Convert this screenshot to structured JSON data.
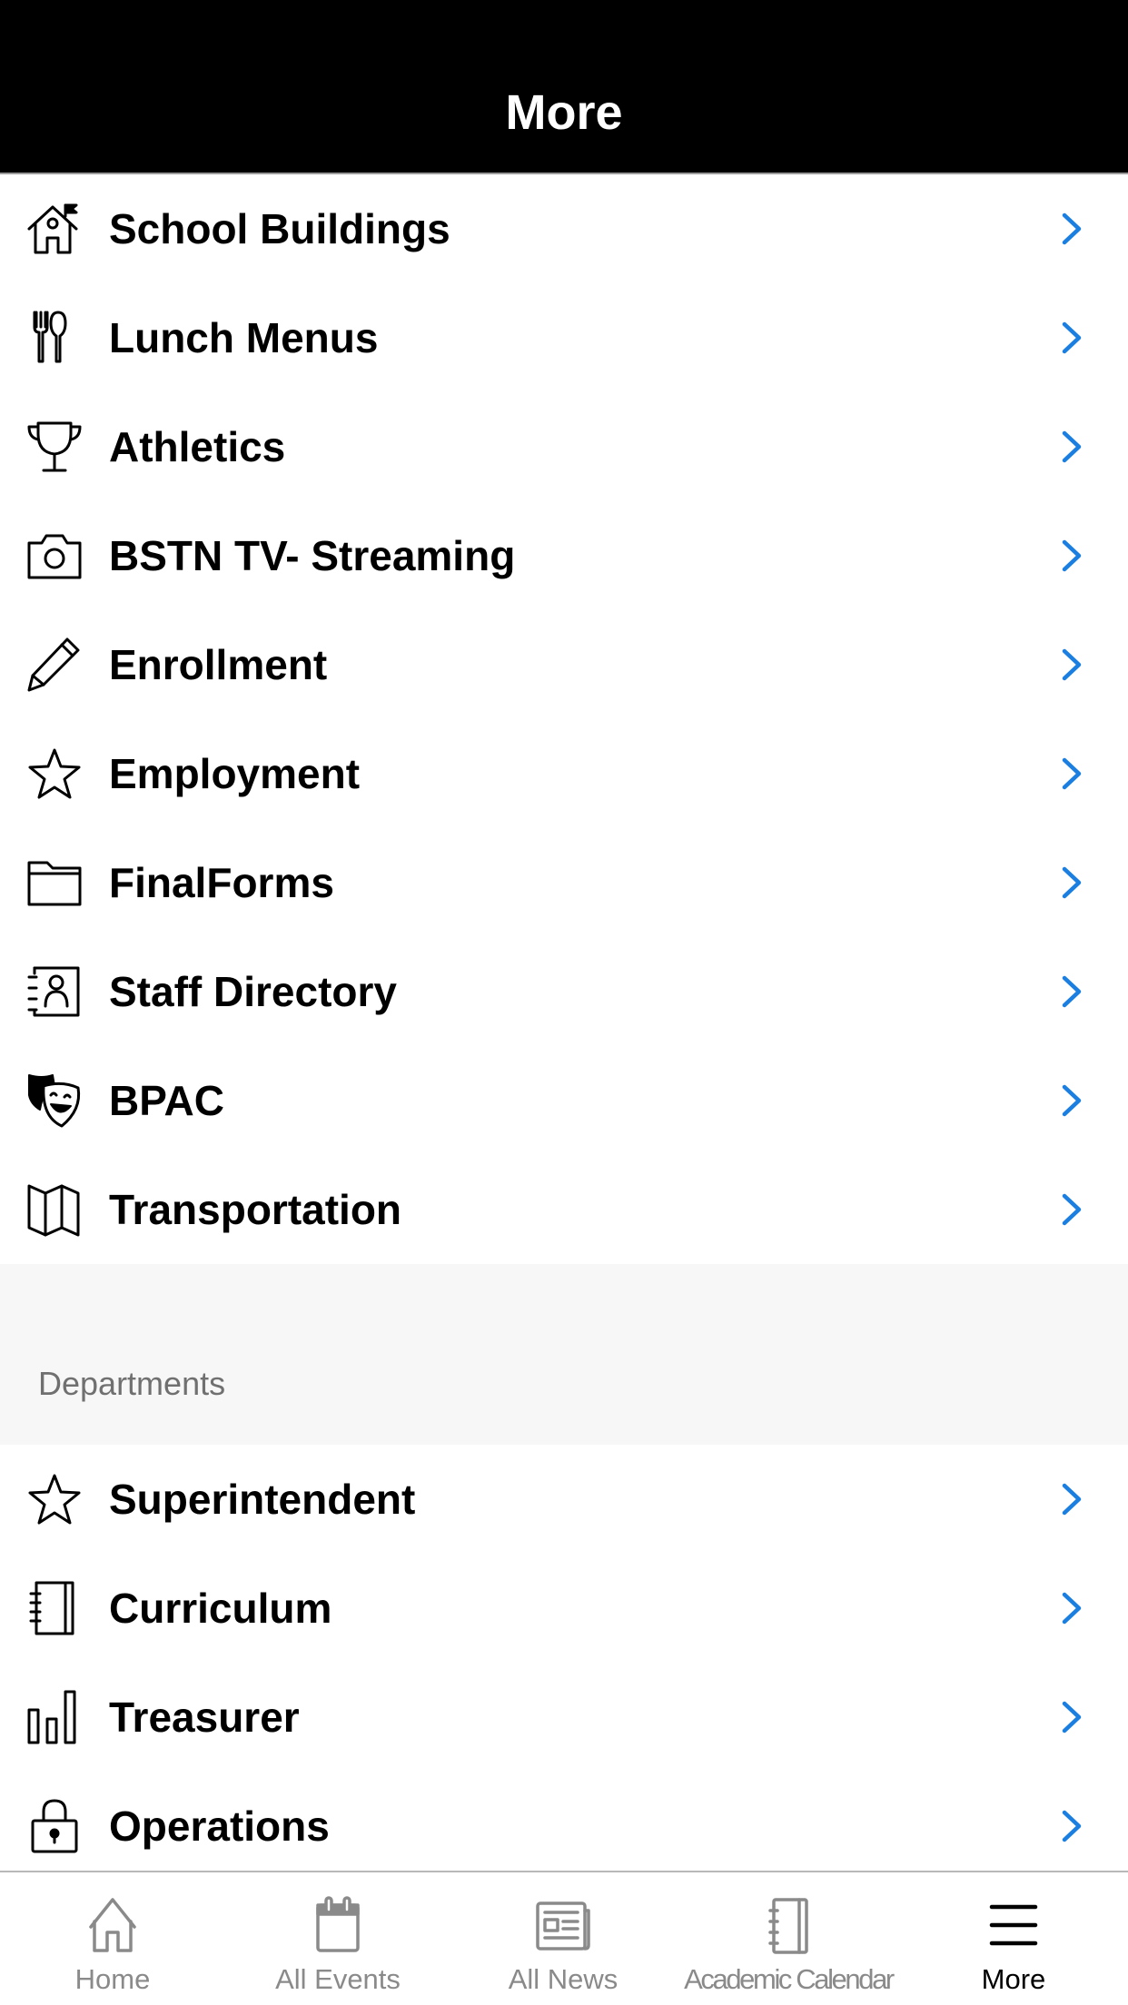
{
  "header": {
    "title": "More"
  },
  "colors": {
    "header_bg": "#000000",
    "chevron": "#1a7fe0",
    "section_bg": "#f7f7f7",
    "tab_inactive": "#8a8a8a",
    "tab_active": "#000000"
  },
  "main_items": [
    {
      "label": "School Buildings",
      "icon": "school-house-flag-icon"
    },
    {
      "label": "Lunch Menus",
      "icon": "fork-spoon-icon"
    },
    {
      "label": "Athletics",
      "icon": "trophy-icon"
    },
    {
      "label": "BSTN TV- Streaming",
      "icon": "camera-icon"
    },
    {
      "label": "Enrollment",
      "icon": "pencil-icon"
    },
    {
      "label": "Employment",
      "icon": "star-icon"
    },
    {
      "label": "FinalForms",
      "icon": "folder-icon"
    },
    {
      "label": "Staff Directory",
      "icon": "contact-book-icon"
    },
    {
      "label": "BPAC",
      "icon": "theater-masks-icon"
    },
    {
      "label": "Transportation",
      "icon": "map-icon"
    }
  ],
  "departments": {
    "title": "Departments",
    "items": [
      {
        "label": "Superintendent",
        "icon": "star-icon"
      },
      {
        "label": "Curriculum",
        "icon": "notebook-icon"
      },
      {
        "label": "Treasurer",
        "icon": "bar-chart-icon"
      },
      {
        "label": "Operations",
        "icon": "lock-icon"
      }
    ]
  },
  "tabbar": {
    "tabs": [
      {
        "label": "Home",
        "icon": "home-icon",
        "active": false
      },
      {
        "label": "All Events",
        "icon": "calendar-icon",
        "active": false
      },
      {
        "label": "All News",
        "icon": "newspaper-icon",
        "active": false
      },
      {
        "label": "Academic Calendar",
        "icon": "notebook-icon",
        "active": false
      },
      {
        "label": "More",
        "icon": "menu-icon",
        "active": true
      }
    ]
  }
}
